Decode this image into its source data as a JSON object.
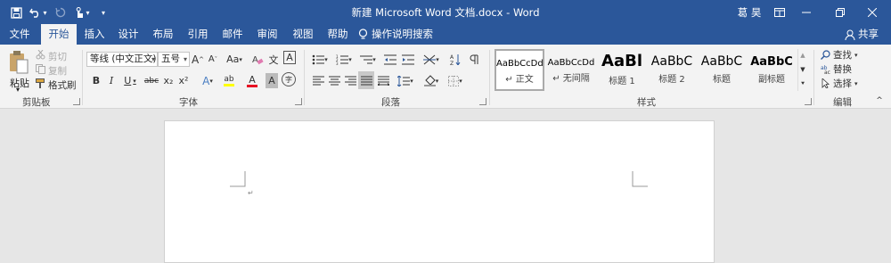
{
  "window": {
    "title": "新建 Microsoft Word 文档.docx  -  Word",
    "user": "葛 昊",
    "share": "共享"
  },
  "tabs": [
    "文件",
    "开始",
    "插入",
    "设计",
    "布局",
    "引用",
    "邮件",
    "审阅",
    "视图",
    "帮助"
  ],
  "tell_me": "操作说明搜索",
  "clipboard": {
    "paste": "粘贴",
    "cut": "剪切",
    "copy": "复制",
    "format_painter": "格式刷",
    "label": "剪贴板"
  },
  "font": {
    "name": "等线 (中文正文)",
    "size": "五号",
    "label": "字体",
    "bold": "B",
    "italic": "I",
    "underline": "U",
    "strike": "abc",
    "sub": "x₂",
    "sup": "x²",
    "grow": "A",
    "shrink": "A",
    "case": "Aa",
    "wen": "文",
    "char_border": "A",
    "highlight": "ab",
    "font_color": "A",
    "char_shade": "A",
    "enclose": "字"
  },
  "paragraph": {
    "label": "段落"
  },
  "styles": {
    "label": "样式",
    "items": [
      {
        "sample": "AaBbCcDd",
        "name": "↵ 正文"
      },
      {
        "sample": "AaBbCcDd",
        "name": "↵ 无间隔"
      },
      {
        "sample": "AaBl",
        "name": "标题 1"
      },
      {
        "sample": "AaBbC",
        "name": "标题 2"
      },
      {
        "sample": "AaBbC",
        "name": "标题"
      },
      {
        "sample": "AaBbC",
        "name": "副标题"
      }
    ]
  },
  "editing": {
    "find": "查找",
    "replace": "替换",
    "select": "选择",
    "label": "编辑"
  },
  "colors": {
    "accent": "#2b579a",
    "highlight": "#ffff00",
    "font_color": "#e81123"
  }
}
